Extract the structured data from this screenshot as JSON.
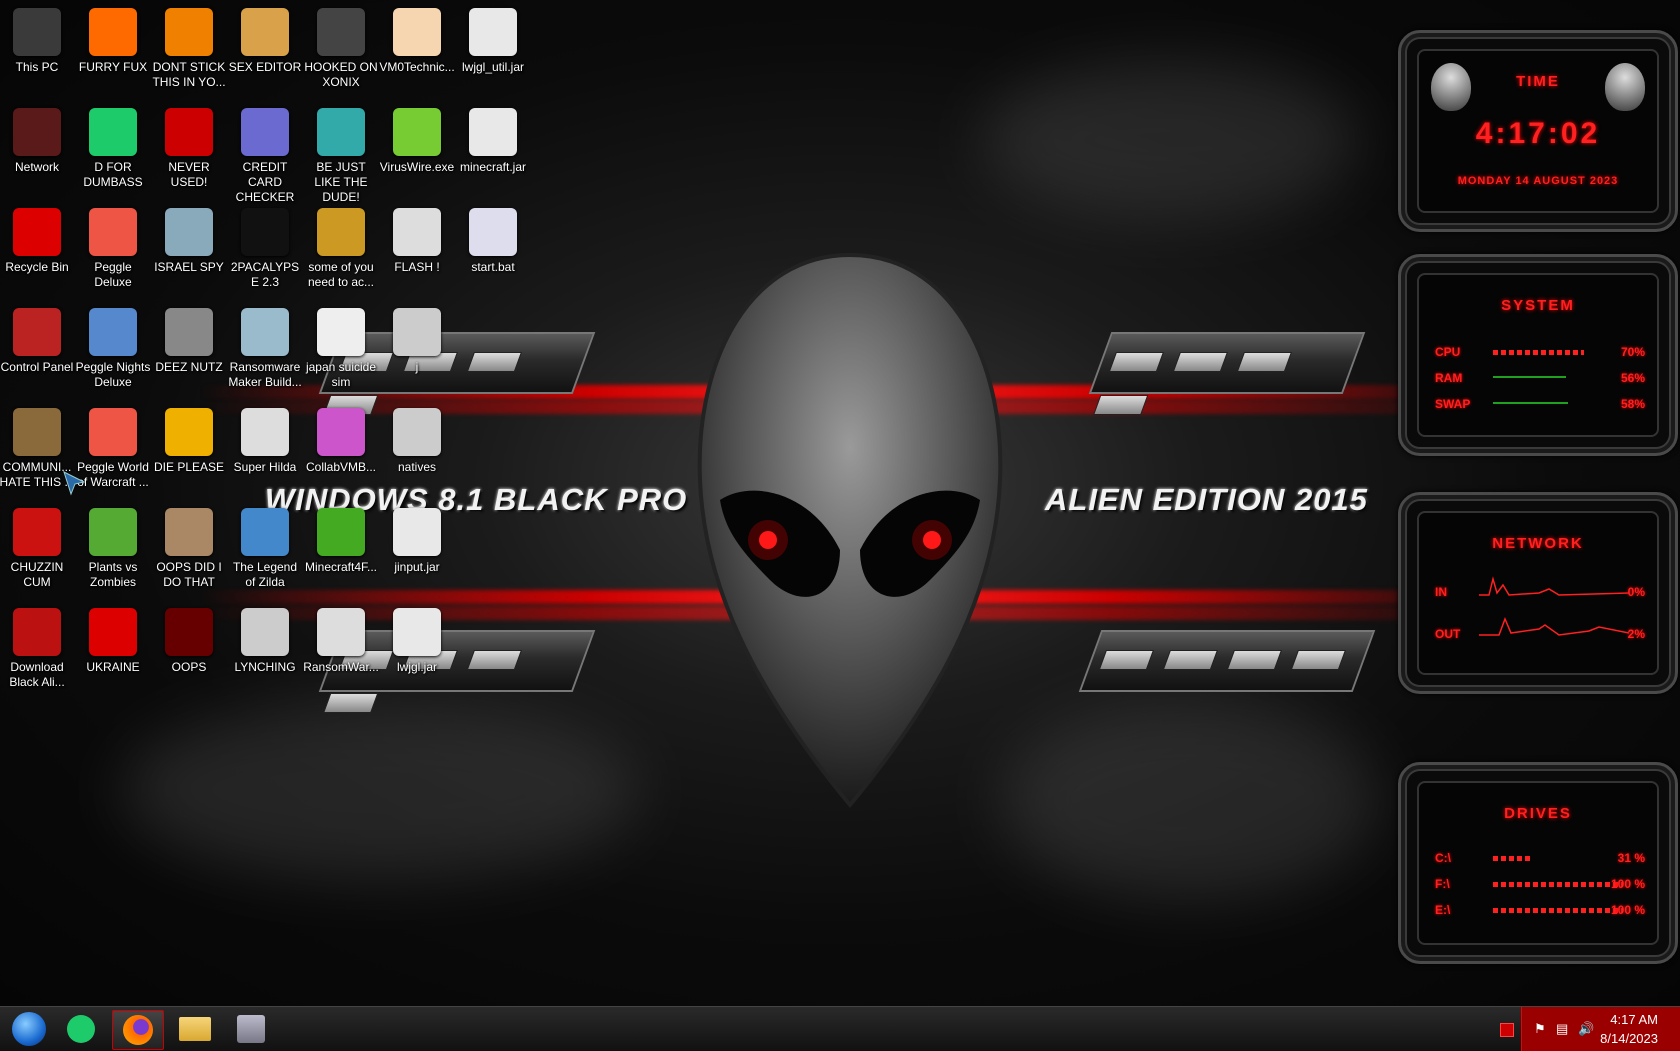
{
  "wallpaper": {
    "banner_left": "WINDOWS 8.1 BLACK PRO",
    "banner_right": "ALIEN EDITION 2015"
  },
  "icons": [
    {
      "label": "This PC",
      "icon": "computer-icon",
      "color": "#3a3a3a"
    },
    {
      "label": "FURRY FUX",
      "icon": "firefox-icon",
      "color": "#ff6a00"
    },
    {
      "label": "DONT STICK THIS IN YO...",
      "icon": "vlc-cone-icon",
      "color": "#f08000"
    },
    {
      "label": "SEX EDITOR",
      "icon": "hex-editor-icon",
      "color": "#d9a24a"
    },
    {
      "label": "HOOKED ON XONIX",
      "icon": "game-icon",
      "color": "#444"
    },
    {
      "label": "VM0Technic...",
      "icon": "doctor-icon",
      "color": "#f5d6b0"
    },
    {
      "label": "lwjgl_util.jar",
      "icon": "java-jar-icon",
      "color": "#e8e8e8"
    },
    {
      "label": "Network",
      "icon": "network-icon",
      "color": "#5a1a1a"
    },
    {
      "label": "D FOR DUMBASS",
      "icon": "notes-icon",
      "color": "#1ecb6b"
    },
    {
      "label": "NEVER USED!",
      "icon": "devcpp-icon",
      "color": "#c00"
    },
    {
      "label": "CREDIT CARD CHECKER",
      "icon": "credit-card-icon",
      "color": "#6a6ad0"
    },
    {
      "label": "BE JUST LIKE THE DUDE!",
      "icon": "wizard-icon",
      "color": "#3aa"
    },
    {
      "label": "VirusWire.exe",
      "icon": "limewire-icon",
      "color": "#7c3"
    },
    {
      "label": "minecraft.jar",
      "icon": "java-jar-icon",
      "color": "#e8e8e8"
    },
    {
      "label": "Recycle Bin",
      "icon": "recycle-bin-icon",
      "color": "#d00"
    },
    {
      "label": "Peggle Deluxe",
      "icon": "peggle-icon",
      "color": "#e54"
    },
    {
      "label": "ISRAEL SPY",
      "icon": "spy-satellite-icon",
      "color": "#8ab"
    },
    {
      "label": "2PACALYPSE 2.3",
      "icon": "console-icon",
      "color": "#111"
    },
    {
      "label": "some of you need to ac...",
      "icon": "dog-icon",
      "color": "#c92"
    },
    {
      "label": "FLASH !",
      "icon": "file-icon",
      "color": "#ddd"
    },
    {
      "label": "start.bat",
      "icon": "gear-file-icon",
      "color": "#dde"
    },
    {
      "label": "Control Panel",
      "icon": "control-panel-icon",
      "color": "#b22"
    },
    {
      "label": "Peggle Nights Deluxe",
      "icon": "peggle-icon",
      "color": "#58c"
    },
    {
      "label": "DEEZ NUTZ",
      "icon": "windows-stack-icon",
      "color": "#888"
    },
    {
      "label": "Ransomware Maker Build...",
      "icon": "app-window-icon",
      "color": "#9bc"
    },
    {
      "label": "japan suicide sim",
      "icon": "paper-file-icon",
      "color": "#eee"
    },
    {
      "label": "j",
      "icon": "file-icon",
      "color": "#ccc"
    },
    {
      "label": "COMMUNI... HATE THIS ...",
      "icon": "money-bag-icon",
      "color": "#8a6a3a"
    },
    {
      "label": "Peggle World of Warcraft ...",
      "icon": "peggle-icon",
      "color": "#e54"
    },
    {
      "label": "DIE PLEASE",
      "icon": "de-icon",
      "color": "#f0b000"
    },
    {
      "label": "Super Hilda",
      "icon": "pixel-art-icon",
      "color": "#ddd"
    },
    {
      "label": "CollabVMB...",
      "icon": "image-viewer-icon",
      "color": "#c5c"
    },
    {
      "label": "natives",
      "icon": "file-icon",
      "color": "#ccc"
    },
    {
      "label": "CHUZZIN CUM",
      "icon": "chuzzle-icon",
      "color": "#c11"
    },
    {
      "label": "Plants vs Zombies",
      "icon": "flower-icon",
      "color": "#5a3"
    },
    {
      "label": "OOPS DID I DO THAT",
      "icon": "portrait-icon",
      "color": "#a86"
    },
    {
      "label": "The Legend of Zilda",
      "icon": "adventure-icon",
      "color": "#48c"
    },
    {
      "label": "Minecraft4F...",
      "icon": "grass-block-icon",
      "color": "#4a2"
    },
    {
      "label": "jinput.jar",
      "icon": "java-jar-icon",
      "color": "#e8e8e8"
    },
    {
      "label": "Download Black Ali...",
      "icon": "alien-download-icon",
      "color": "#b11"
    },
    {
      "label": "UKRAINE",
      "icon": "radiation-icon",
      "color": "#d00"
    },
    {
      "label": "OOPS",
      "icon": "book-icon",
      "color": "#600"
    },
    {
      "label": "LYNCHING",
      "icon": "gear-flag-icon",
      "color": "#ccc"
    },
    {
      "label": "RansomWar...",
      "icon": "skull-icon",
      "color": "#ddd"
    },
    {
      "label": "lwjgl.jar",
      "icon": "java-jar-icon",
      "color": "#e8e8e8"
    }
  ],
  "widgets": {
    "time": {
      "title": "TIME",
      "clock": "4:17:02",
      "date": "MONDAY 14 AUGUST 2023"
    },
    "system": {
      "title": "SYSTEM",
      "rows": [
        {
          "key": "CPU",
          "value": "70%",
          "level": 0.7
        },
        {
          "key": "RAM",
          "value": "56%",
          "level": 0.56
        },
        {
          "key": "SWAP",
          "value": "58%",
          "level": 0.58
        }
      ]
    },
    "network": {
      "title": "NETWORK",
      "rows": [
        {
          "key": "IN",
          "value": "0%"
        },
        {
          "key": "OUT",
          "value": "2%"
        }
      ]
    },
    "drives": {
      "title": "DRIVES",
      "rows": [
        {
          "key": "C:\\",
          "value": "31 %",
          "level": 0.31
        },
        {
          "key": "F:\\",
          "value": "100 %",
          "level": 1.0
        },
        {
          "key": "E:\\",
          "value": "100 %",
          "level": 1.0
        }
      ]
    }
  },
  "taskbar": {
    "apps": [
      {
        "name": "start-orb",
        "icon": "start-orb-icon"
      },
      {
        "name": "notes",
        "icon": "notes-icon"
      },
      {
        "name": "firefox",
        "icon": "firefox-icon",
        "active": true
      },
      {
        "name": "file-explorer",
        "icon": "folder-icon"
      },
      {
        "name": "app",
        "icon": "app-window-icon"
      }
    ],
    "clock_time": "4:17 AM",
    "clock_date": "8/14/2023"
  }
}
